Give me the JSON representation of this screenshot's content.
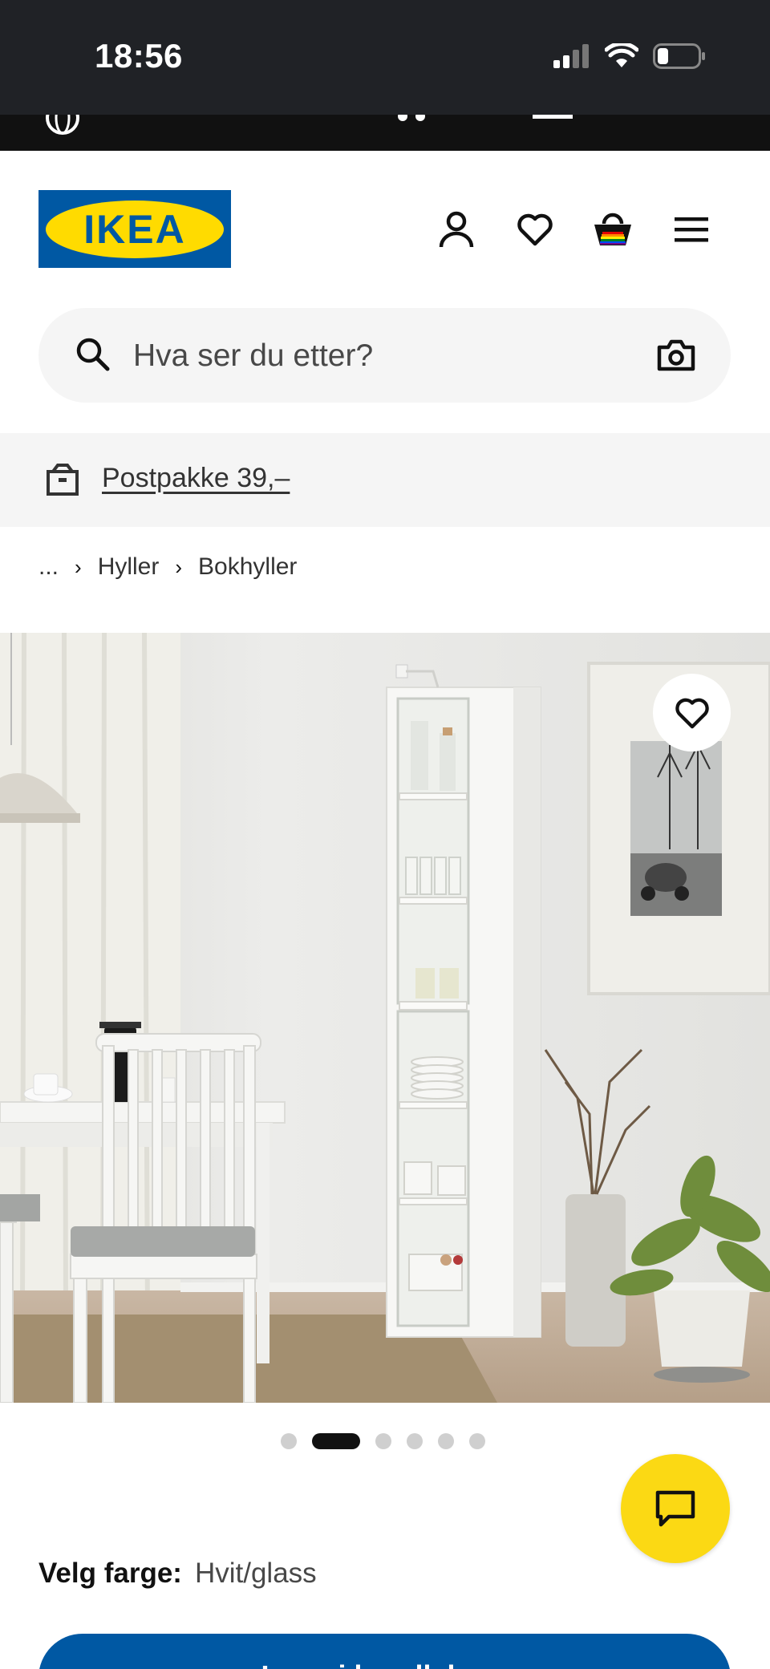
{
  "status_bar": {
    "time": "18:56"
  },
  "header": {
    "logo_text": "IKEA"
  },
  "search": {
    "placeholder": "Hva ser du etter?"
  },
  "promo": {
    "link_text": "Postpakke 39,–"
  },
  "breadcrumb": {
    "ellipsis": "...",
    "items": [
      "Hyller",
      "Bokhyller"
    ]
  },
  "gallery": {
    "image_count": 6,
    "active_index": 1
  },
  "product": {
    "color_label": "Velg farge:",
    "color_value": "Hvit/glass"
  },
  "cta": {
    "label": "Legg i handlekurv"
  },
  "colors": {
    "brand_blue": "#0058a3",
    "brand_yellow": "#ffdb00",
    "chat_yellow": "#fbd914",
    "status_bar_bg": "#202226"
  }
}
